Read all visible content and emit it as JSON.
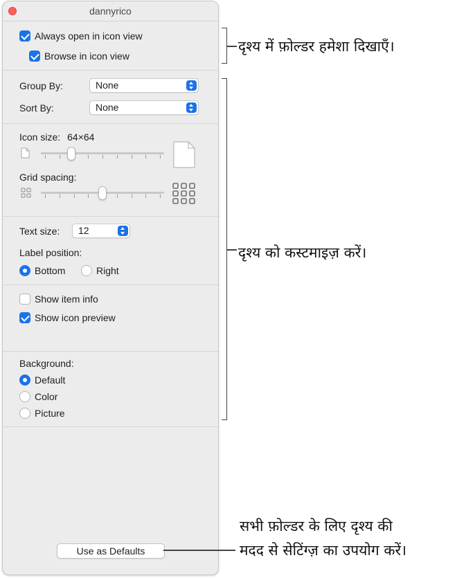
{
  "window": {
    "title": "dannyrico"
  },
  "view_options": {
    "always_open_label": "Always open in icon view",
    "always_open_checked": true,
    "browse_label": "Browse in icon view",
    "browse_checked": true
  },
  "group_sort": {
    "group_by_label": "Group By:",
    "group_by_value": "None",
    "sort_by_label": "Sort By:",
    "sort_by_value": "None"
  },
  "icon_size": {
    "label": "Icon size:",
    "value_text": "64×64",
    "slider_level": 0.23
  },
  "grid_spacing": {
    "label": "Grid spacing:",
    "slider_level": 0.5
  },
  "text": {
    "text_size_label": "Text size:",
    "text_size_value": "12",
    "label_position_label": "Label position:",
    "options": [
      "Bottom",
      "Right"
    ],
    "selected": "Bottom"
  },
  "item_options": {
    "show_item_info_label": "Show item info",
    "show_item_info_checked": false,
    "show_icon_preview_label": "Show icon preview",
    "show_icon_preview_checked": true
  },
  "background": {
    "label": "Background:",
    "options": [
      "Default",
      "Color",
      "Picture"
    ],
    "selected": "Default"
  },
  "defaults_button": {
    "label": "Use as Defaults"
  },
  "annotations": {
    "top": "दृश्य में फ़ोल्डर हमेशा दिखाएँ।",
    "middle": "दृश्य को कस्टमाइज़ करें।",
    "bottom_line1": "सभी फ़ोल्डर के लिए दृश्य की",
    "bottom_line2": "मदद से सेटिंग्ज़ का उपयोग करें।"
  },
  "colors": {
    "accent": "#1a73e8",
    "close": "#ff5f57"
  }
}
